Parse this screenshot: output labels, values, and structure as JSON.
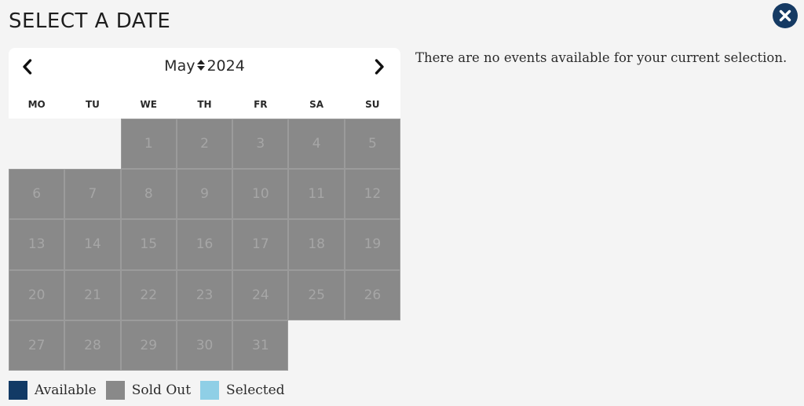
{
  "dialog": {
    "title": "SELECT A DATE",
    "close_icon": "close-x-icon"
  },
  "calendar": {
    "month": "May",
    "year": "2024",
    "prev_icon": "chevron-left-icon",
    "next_icon": "chevron-right-icon",
    "month_select_icon": "sort-updown-icon",
    "weekdays": [
      "MO",
      "TU",
      "WE",
      "TH",
      "FR",
      "SA",
      "SU"
    ],
    "leading_blank_days": 2,
    "days": [
      {
        "label": "1",
        "status": "sold-out"
      },
      {
        "label": "2",
        "status": "sold-out"
      },
      {
        "label": "3",
        "status": "sold-out"
      },
      {
        "label": "4",
        "status": "sold-out"
      },
      {
        "label": "5",
        "status": "sold-out"
      },
      {
        "label": "6",
        "status": "sold-out"
      },
      {
        "label": "7",
        "status": "sold-out"
      },
      {
        "label": "8",
        "status": "sold-out"
      },
      {
        "label": "9",
        "status": "sold-out"
      },
      {
        "label": "10",
        "status": "sold-out"
      },
      {
        "label": "11",
        "status": "sold-out"
      },
      {
        "label": "12",
        "status": "sold-out"
      },
      {
        "label": "13",
        "status": "sold-out"
      },
      {
        "label": "14",
        "status": "sold-out"
      },
      {
        "label": "15",
        "status": "sold-out"
      },
      {
        "label": "16",
        "status": "sold-out"
      },
      {
        "label": "17",
        "status": "sold-out"
      },
      {
        "label": "18",
        "status": "sold-out"
      },
      {
        "label": "19",
        "status": "sold-out"
      },
      {
        "label": "20",
        "status": "sold-out"
      },
      {
        "label": "21",
        "status": "sold-out"
      },
      {
        "label": "22",
        "status": "sold-out"
      },
      {
        "label": "23",
        "status": "sold-out"
      },
      {
        "label": "24",
        "status": "sold-out"
      },
      {
        "label": "25",
        "status": "sold-out"
      },
      {
        "label": "26",
        "status": "sold-out"
      },
      {
        "label": "27",
        "status": "sold-out"
      },
      {
        "label": "28",
        "status": "sold-out"
      },
      {
        "label": "29",
        "status": "sold-out"
      },
      {
        "label": "30",
        "status": "sold-out"
      },
      {
        "label": "31",
        "status": "sold-out"
      }
    ]
  },
  "message": "There are no events available for your current selection.",
  "legend": [
    {
      "label": "Available",
      "color": "#123a65"
    },
    {
      "label": "Sold Out",
      "color": "#898989"
    },
    {
      "label": "Selected",
      "color": "#8fcfe6"
    }
  ],
  "colors": {
    "background": "#f4f4f4",
    "accent": "#153a63",
    "sold_out_cell": "#898989",
    "day_number": "#a6a6a6"
  }
}
